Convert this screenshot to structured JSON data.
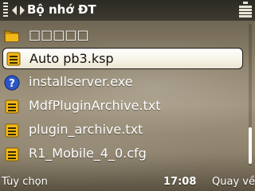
{
  "title_bar": {
    "title": "Bộ nhớ ĐT",
    "signal_icon": "signal-strength-icon",
    "nav_icon": "navigation-arrows-icon",
    "battery_icon": "battery-icon"
  },
  "file_list": {
    "items": [
      {
        "label": "□□□□□",
        "icon": "folder-icon",
        "selected": false
      },
      {
        "label": "Auto pb3.ksp",
        "icon": "file-icon",
        "selected": true
      },
      {
        "label": "installserver.exe",
        "icon": "unknown-file-icon",
        "selected": false
      },
      {
        "label": "MdfPluginArchive.txt",
        "icon": "file-icon",
        "selected": false
      },
      {
        "label": "plugin_archive.txt",
        "icon": "file-icon",
        "selected": false
      },
      {
        "label": "R1_Mobile_4_0.cfg",
        "icon": "file-icon",
        "selected": false
      }
    ]
  },
  "softkeys": {
    "left_label": "Tùy chọn",
    "clock": "17:08",
    "right_label": "Quay về"
  },
  "colors": {
    "accent_yellow": "#f2b817",
    "unknown_icon_blue": "#2a56c8",
    "highlight_bg": "#f7f3e7",
    "background": "#8a7f68"
  }
}
